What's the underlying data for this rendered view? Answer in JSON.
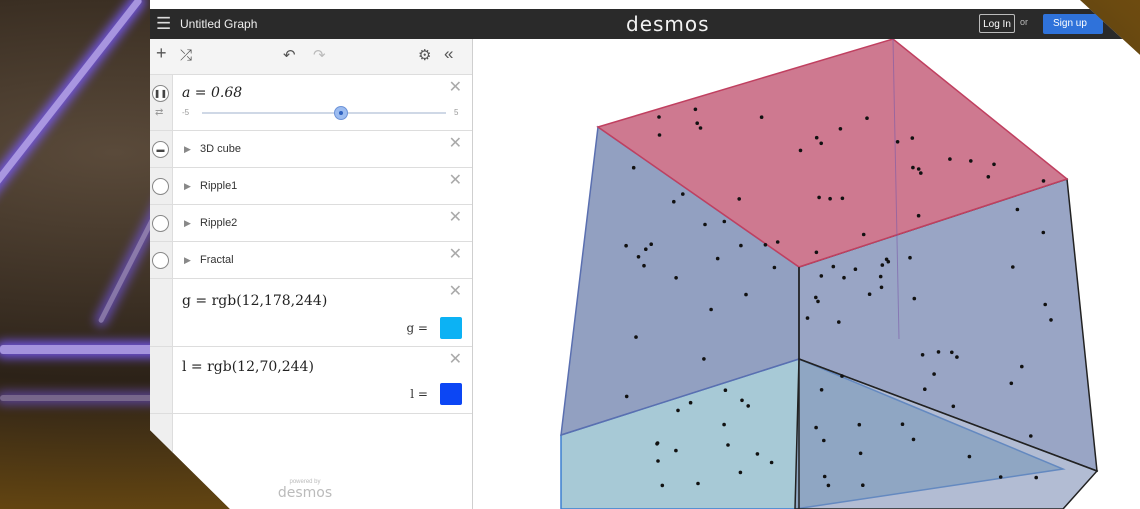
{
  "topbar": {
    "graph_title": "Untitled Graph",
    "brand": "desmos",
    "login_label": "Log In",
    "or_text": "or",
    "signup_label": "Sign up"
  },
  "toolbar": {
    "add_icon": "plus-icon",
    "shuffle_icon": "shuffle-icon",
    "undo_icon": "undo-icon",
    "redo_icon": "redo-icon",
    "settings_icon": "gear-icon",
    "collapse_icon": "double-chevron-left-icon"
  },
  "expressions": [
    {
      "type": "slider",
      "math": "a = 0.68",
      "min": "-5",
      "max": "5",
      "value": 0.68
    },
    {
      "type": "folder",
      "label": "3D cube"
    },
    {
      "type": "folder",
      "label": "Ripple1"
    },
    {
      "type": "folder",
      "label": "Ripple2"
    },
    {
      "type": "folder",
      "label": "Fractal"
    },
    {
      "type": "color",
      "math": "g = rgb(12,178,244)",
      "swatch_label": "g =",
      "color": "#0cb2f4"
    },
    {
      "type": "color",
      "math": "l = rgb(12,70,244)",
      "swatch_label": "l =",
      "color": "#0c46f4"
    }
  ],
  "powered_by": {
    "small": "powered by",
    "brand": "desmos"
  },
  "graph": {
    "top_face_color": "#c96a84",
    "side_face_color": "#7f8fb6",
    "bottom_face_color": "#8ab7c8"
  }
}
